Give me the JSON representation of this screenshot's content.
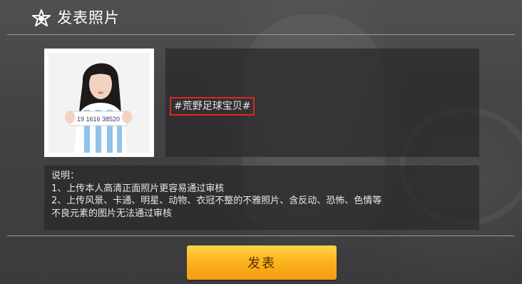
{
  "header": {
    "title": "发表照片",
    "logo_icon": "soccer-star-icon"
  },
  "photo": {
    "sign_text": "19 1616 38520"
  },
  "caption": {
    "text": "#荒野足球宝贝#",
    "highlight_color": "#e0261c"
  },
  "info": {
    "heading": "说明：",
    "lines": [
      "1、上传本人高清正面照片更容易通过审核",
      "2、上传风景、卡通、明星、动物、衣冠不整的不雅照片、含反动、恐怖、色情等",
      "不良元素的图片无法通过审核"
    ]
  },
  "submit": {
    "label": "发表",
    "color": "#fbb21b"
  }
}
